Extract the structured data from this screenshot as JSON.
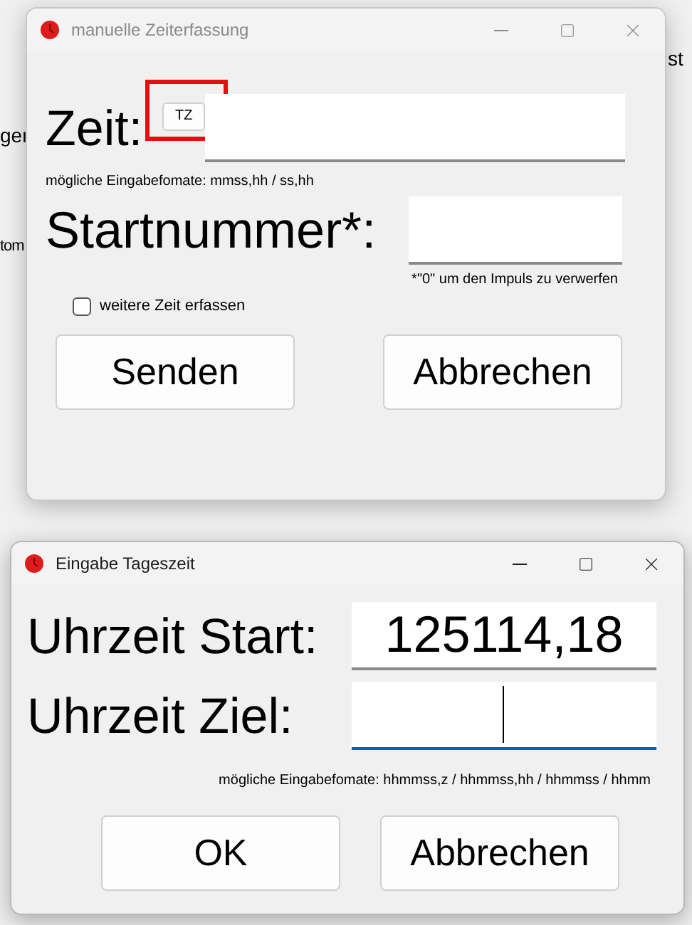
{
  "background": {
    "fragments": [
      "st",
      "ger",
      "tom"
    ]
  },
  "time_dialog": {
    "title": "manuelle Zeiterfassung",
    "active": false,
    "time_label": "Zeit:",
    "tz_button": {
      "label": "TZ",
      "highlighted": true
    },
    "time_hint": "mögliche Eingabefomate: mmss,hh / ss,hh",
    "bib_label": "Startnummer*:",
    "bib_note": "*\"0\" um den Impuls zu verwerfen",
    "more_checkbox": {
      "label": "weitere Zeit erfassen",
      "checked": false
    },
    "buttons": [
      "Senden",
      "Abbrechen"
    ]
  },
  "daytime_dialog": {
    "title": "Eingabe Tageszeit",
    "active": true,
    "start_label": "Uhrzeit Start:",
    "start_field": {
      "value": "125114,18",
      "focused": false
    },
    "goal_label": "Uhrzeit Ziel:",
    "goal_field": {
      "focused": true
    },
    "hint": "mögliche Eingabefomate: hhmmss,z / hhmmss,hh / hhmmss / hhmm",
    "buttons": [
      "OK",
      "Abbrechen"
    ]
  }
}
